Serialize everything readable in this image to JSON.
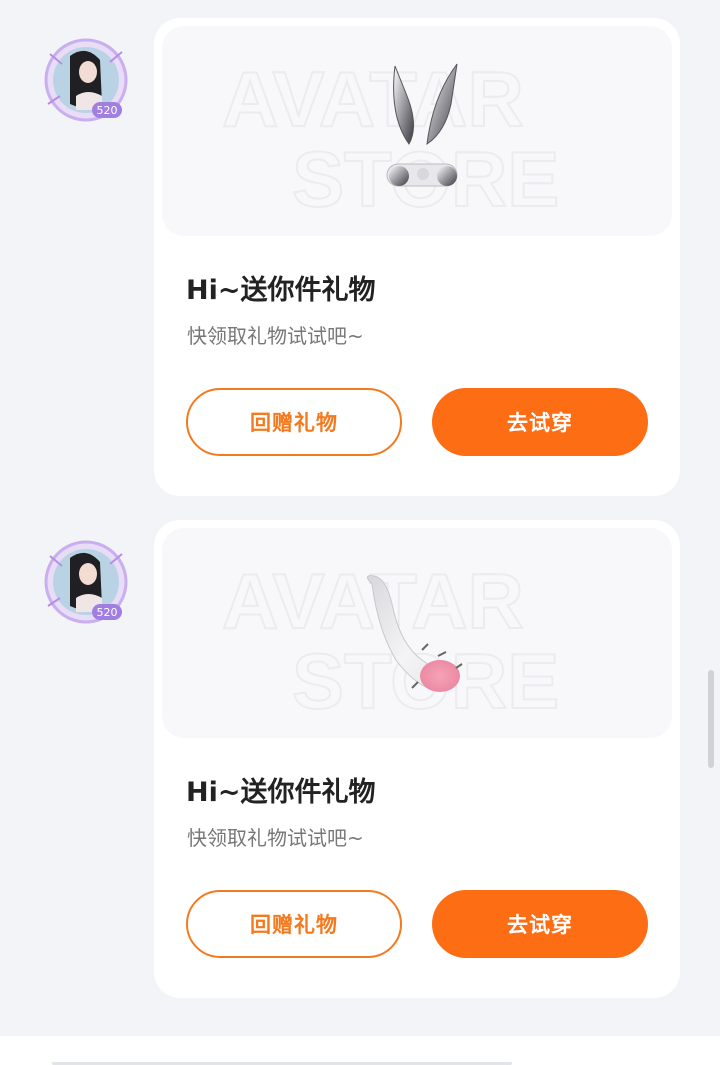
{
  "messages": [
    {
      "title": "Hi~送你件礼物",
      "subtitle": "快领取礼物试试吧~",
      "gift_back_label": "回赠礼物",
      "try_on_label": "去试穿",
      "item_icon": "silver-bunny-ears-headband-icon",
      "watermark": [
        "AVATAR",
        "STORE"
      ],
      "avatar_badge": "520"
    },
    {
      "title": "Hi~送你件礼物",
      "subtitle": "快领取礼物试试吧~",
      "gift_back_label": "回赠礼物",
      "try_on_label": "去试穿",
      "item_icon": "white-spiked-tail-icon",
      "watermark": [
        "AVATAR",
        "STORE"
      ],
      "avatar_badge": "520"
    }
  ],
  "colors": {
    "accent": "#fc6d14",
    "outline": "#f47a20",
    "page_bg": "#f3f4f7",
    "card_bg": "#ffffff"
  }
}
